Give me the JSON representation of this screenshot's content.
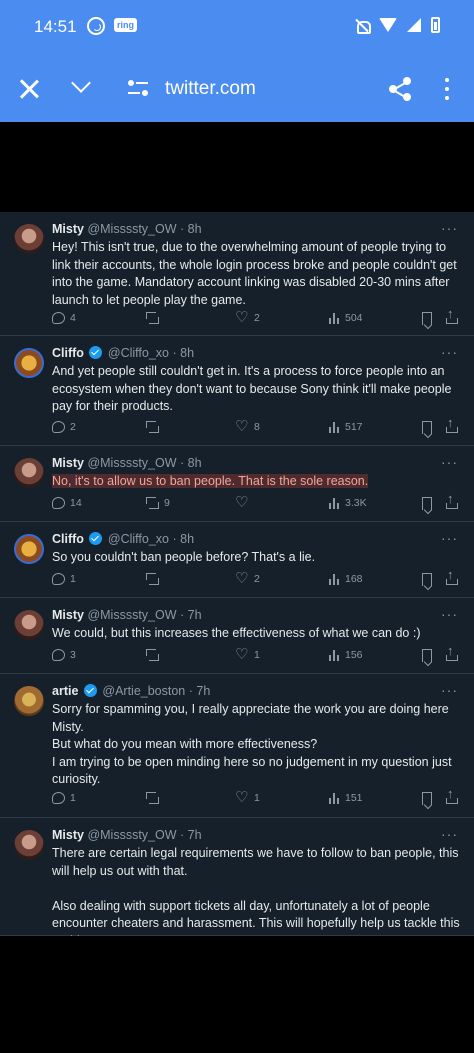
{
  "status_bar": {
    "time": "14:51",
    "ring_badge": "ring"
  },
  "browser": {
    "url": "twitter.com"
  },
  "tweets": [
    {
      "name": "Misty",
      "handle": "@Missssty_OW",
      "time": "8h",
      "avatar": "misty",
      "verified": false,
      "text": "Hey! This isn't true, due to the overwhelming amount of people trying to link their accounts, the whole login process broke and people couldn't get into the game. Mandatory account linking was disabled 20-30 mins after launch to let people play the game.",
      "highlight": false,
      "replies": "4",
      "retweets": "",
      "likes": "2",
      "views": "504"
    },
    {
      "name": "Cliffo",
      "handle": "@Cliffo_xo",
      "time": "8h",
      "avatar": "cliffo",
      "verified": true,
      "text": "And yet people still couldn't get in. It's a process to force people into an ecosystem when they don't want to because Sony think it'll make people pay for their products.",
      "highlight": false,
      "replies": "2",
      "retweets": "",
      "likes": "8",
      "views": "517"
    },
    {
      "name": "Misty",
      "handle": "@Missssty_OW",
      "time": "8h",
      "avatar": "misty",
      "verified": false,
      "text": "No, it's to allow us to ban people. That is the sole reason.",
      "highlight": true,
      "replies": "14",
      "retweets": "9",
      "likes": "",
      "views": "3.3K"
    },
    {
      "name": "Cliffo",
      "handle": "@Cliffo_xo",
      "time": "8h",
      "avatar": "cliffo",
      "verified": true,
      "text": "So you couldn't ban people before? That's a lie.",
      "highlight": false,
      "replies": "1",
      "retweets": "",
      "likes": "2",
      "views": "168"
    },
    {
      "name": "Misty",
      "handle": "@Missssty_OW",
      "time": "7h",
      "avatar": "misty",
      "verified": false,
      "text": "We could, but this increases the effectiveness of what we can do :)",
      "highlight": false,
      "replies": "3",
      "retweets": "",
      "likes": "1",
      "views": "156"
    },
    {
      "name": "artie",
      "handle": "@Artie_boston",
      "time": "7h",
      "avatar": "artie",
      "verified": true,
      "text": "Sorry for spamming you, I really appreciate the work you are doing here Misty.\nBut what do you mean with more effectiveness?\nI am trying to be open minding here so no judgement in my question just curiosity.",
      "highlight": false,
      "replies": "1",
      "retweets": "",
      "likes": "1",
      "views": "151"
    },
    {
      "name": "Misty",
      "handle": "@Missssty_OW",
      "time": "7h",
      "avatar": "misty",
      "verified": false,
      "text": "There are certain legal requirements we have to follow to ban people, this will help us out with that.\n\nAlso dealing with support tickets all day, unfortunately a lot of people encounter cheaters and harassment. This will hopefully help us tackle this problem!",
      "highlight": false,
      "replies": "",
      "retweets": "",
      "likes": "",
      "views": ""
    }
  ]
}
